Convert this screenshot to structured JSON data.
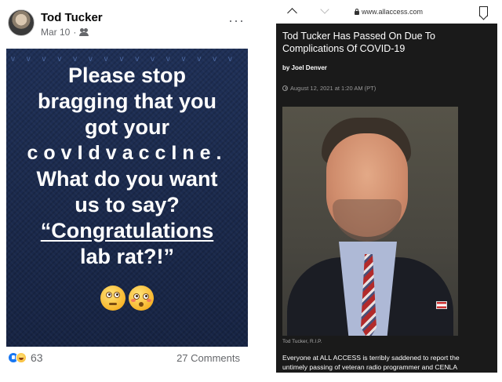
{
  "facebook_post": {
    "author": "Tod Tucker",
    "date": "Mar 10",
    "separator": "·",
    "audience_icon": "friends-icon",
    "more_label": "···",
    "meme": {
      "dots": "v v v v v v v v v v v v v v v v v",
      "lines": [
        "Please stop",
        "bragging that you",
        "got your",
        "covIdvaccIne.",
        "What do you want",
        "us to say?",
        "“Congratulations",
        "lab rat?!”"
      ],
      "emojis": [
        "face-with-rolling-eyes",
        "flushed-face"
      ]
    },
    "reaction_icons": [
      "like-icon",
      "haha-icon"
    ],
    "reaction_count": "63",
    "comments": "27 Comments"
  },
  "browser": {
    "url": "www.allaccess.com",
    "icons": [
      "chevron-up-icon",
      "chevron-down-icon",
      "lock-icon",
      "bookmark-icon"
    ]
  },
  "article": {
    "title": "Tod Tucker Has Passed On Due To Complications Of COVID-19",
    "byline": "by Joel Denver",
    "date": "August 12, 2021 at 1:20 AM (PT)",
    "photo_caption": "Tod Tucker, R.I.P.",
    "body_lines": [
      "Everyone at ALL ACCESS is terribly saddened to report the",
      "untimely passing of veteran radio programmer and CENLA"
    ]
  },
  "colors": {
    "fb_text": "#050505",
    "fb_secondary": "#65676b",
    "meme_bg": "#1b2a4d",
    "article_bg": "#1a1a1a",
    "like_blue": "#1877f2"
  }
}
